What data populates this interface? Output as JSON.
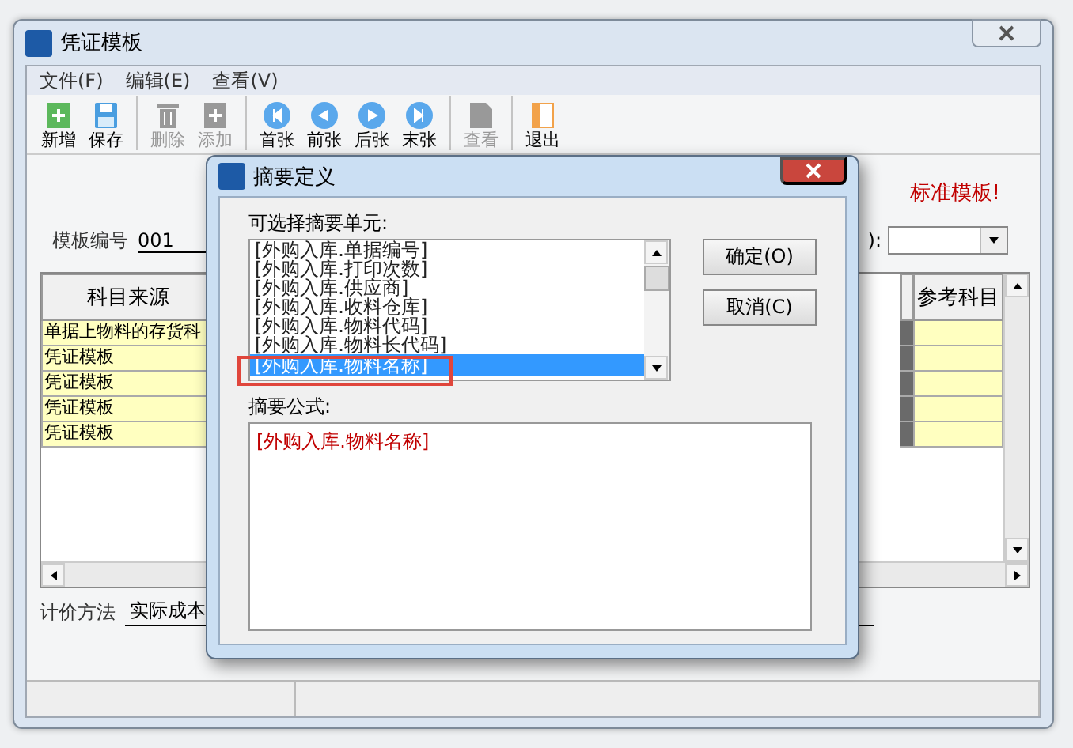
{
  "window": {
    "title": "凭证模板"
  },
  "menu": [
    "文件(F)",
    "编辑(E)",
    "查看(V)"
  ],
  "toolbar": [
    {
      "label": "新增",
      "kind": "new",
      "disabled": false
    },
    {
      "label": "保存",
      "kind": "save",
      "disabled": false
    },
    {
      "label": "删除",
      "kind": "delete",
      "disabled": true
    },
    {
      "label": "添加",
      "kind": "add",
      "disabled": true
    },
    {
      "label": "首张",
      "kind": "first",
      "disabled": false
    },
    {
      "label": "前张",
      "kind": "prev",
      "disabled": false
    },
    {
      "label": "后张",
      "kind": "next",
      "disabled": false
    },
    {
      "label": "末张",
      "kind": "last",
      "disabled": false
    },
    {
      "label": "查看",
      "kind": "view",
      "disabled": true
    },
    {
      "label": "退出",
      "kind": "exit",
      "disabled": false
    }
  ],
  "notice": "标准模板!",
  "form": {
    "template_no_label": "模板编号",
    "template_no": "001",
    "field_2_label": "):"
  },
  "table": {
    "columns": [
      "科目来源",
      "参考科目"
    ],
    "rows": [
      {
        "source": "单据上物料的存货科"
      },
      {
        "source": "凭证模板"
      },
      {
        "source": "凭证模板"
      },
      {
        "source": "凭证模板"
      },
      {
        "source": "凭证模板"
      }
    ]
  },
  "footer": {
    "label": "计价方法",
    "value": "实际成本"
  },
  "dialog": {
    "title": "摘要定义",
    "list_label": "可选择摘要单元:",
    "items": [
      {
        "text": "[外购入库.单据编号]",
        "selected": false
      },
      {
        "text": "[外购入库.打印次数]",
        "selected": false
      },
      {
        "text": "[外购入库.供应商]",
        "selected": false
      },
      {
        "text": "[外购入库.收料仓库]",
        "selected": false
      },
      {
        "text": "[外购入库.物料代码]",
        "selected": false
      },
      {
        "text": "[外购入库.物料长代码]",
        "selected": false
      },
      {
        "text": "[外购入库.物料名称]",
        "selected": true
      }
    ],
    "buttons": [
      "确定(O)",
      "取消(C)"
    ],
    "formula_label": "摘要公式:",
    "formula": "[外购入库.物料名称]"
  }
}
